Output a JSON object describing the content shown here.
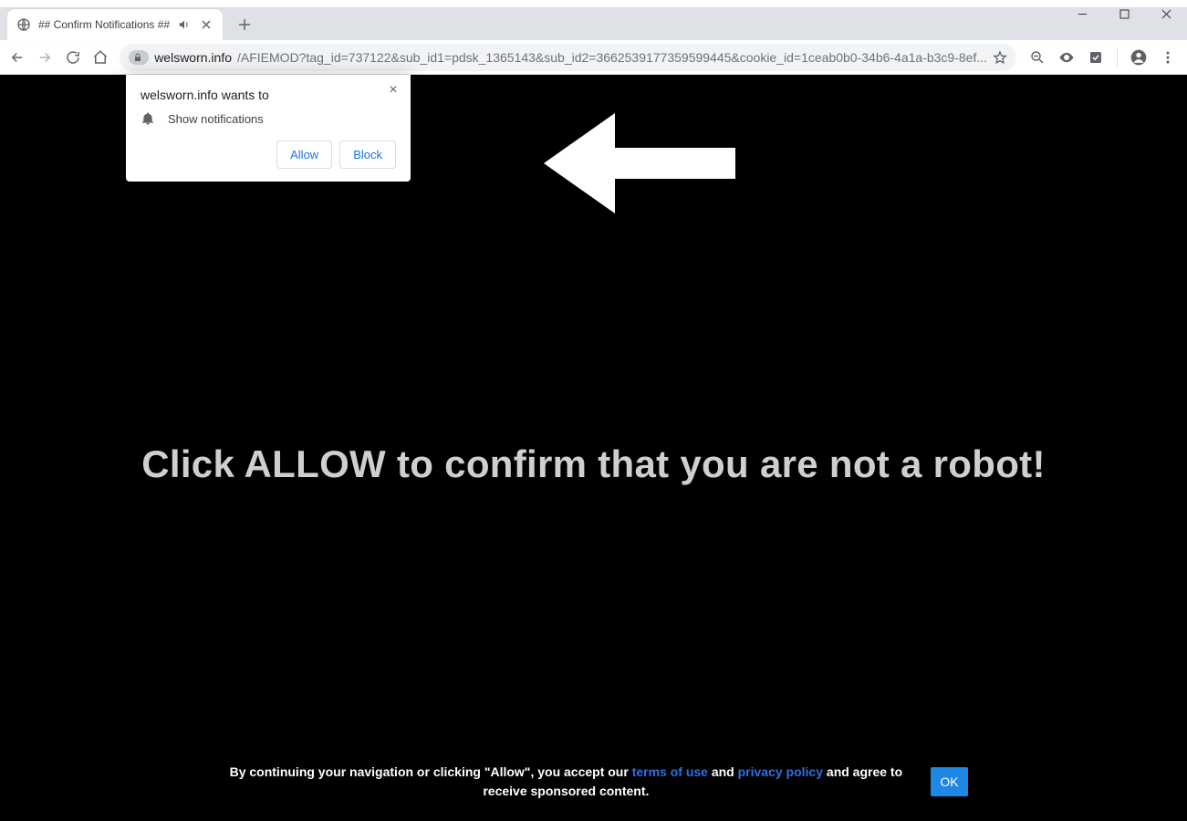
{
  "tab": {
    "title": "## Confirm Notifications ##"
  },
  "omnibox": {
    "domain": "welsworn.info",
    "path": "/AFIEMOD?tag_id=737122&sub_id1=pdsk_1365143&sub_id2=3662539177359599445&cookie_id=1ceab0b0-34b6-4a1a-b3c9-8ef..."
  },
  "permission": {
    "title": "welsworn.info wants to",
    "item": "Show notifications",
    "allow": "Allow",
    "block": "Block"
  },
  "page": {
    "headline": "Click ALLOW to confirm that you are not a robot!"
  },
  "footer": {
    "pre": "By continuing your navigation or clicking \"Allow\", you accept our ",
    "terms": "terms of use",
    "mid": " and ",
    "privacy": "privacy policy",
    "post": " and agree to receive sponsored content.",
    "ok": "OK"
  }
}
